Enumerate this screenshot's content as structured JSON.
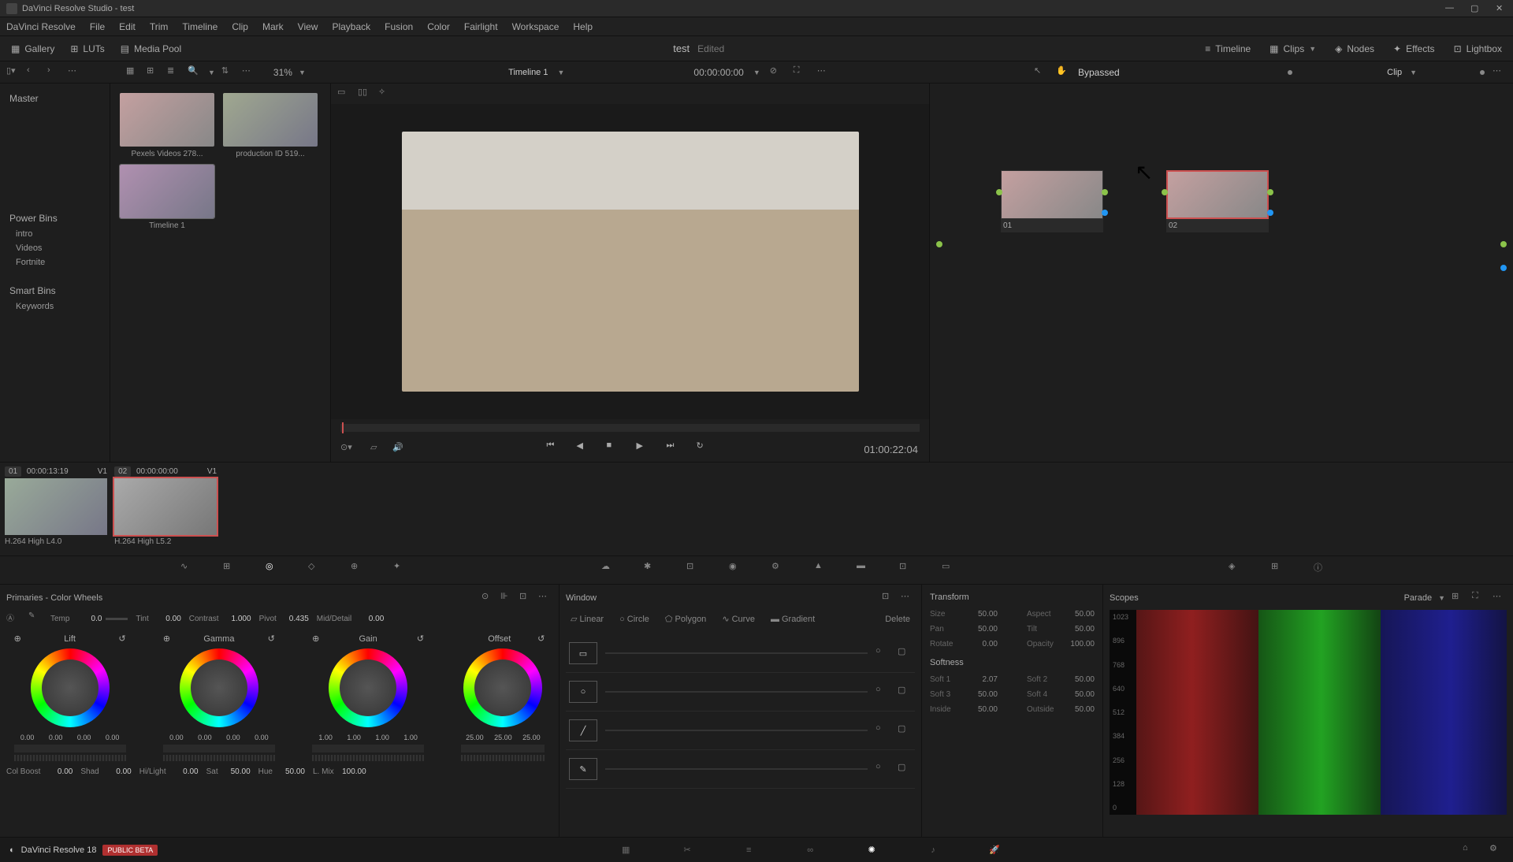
{
  "titlebar": {
    "title": "DaVinci Resolve Studio - test"
  },
  "menubar": [
    "DaVinci Resolve",
    "File",
    "Edit",
    "Trim",
    "Timeline",
    "Clip",
    "Mark",
    "View",
    "Playback",
    "Fusion",
    "Color",
    "Fairlight",
    "Workspace",
    "Help"
  ],
  "toolbar": {
    "gallery": "Gallery",
    "luts": "LUTs",
    "mediapool": "Media Pool",
    "project": "test",
    "status": "Edited",
    "timeline": "Timeline",
    "clips": "Clips",
    "nodes": "Nodes",
    "effects": "Effects",
    "lightbox": "Lightbox"
  },
  "sectoolbar": {
    "zoom": "31%",
    "timeline_name": "Timeline 1",
    "timecode": "00:00:00:00",
    "bypassed": "Bypassed",
    "clip_label": "Clip"
  },
  "sidebar": {
    "master": "Master",
    "powerbins": "Power Bins",
    "power_items": [
      "intro",
      "Videos",
      "Fortnite"
    ],
    "smartbins": "Smart Bins",
    "smart_items": [
      "Keywords"
    ]
  },
  "media": {
    "items": [
      {
        "label": "Pexels Videos 278..."
      },
      {
        "label": "production ID 519..."
      },
      {
        "label": "Timeline 1"
      }
    ]
  },
  "viewer": {
    "timecode": "01:00:22:04"
  },
  "nodes": [
    {
      "label": "01",
      "selected": false
    },
    {
      "label": "02",
      "selected": true
    }
  ],
  "clips": [
    {
      "num": "01",
      "tc": "00:00:13:19",
      "track": "V1",
      "codec": "H.264 High L4.0",
      "selected": false
    },
    {
      "num": "02",
      "tc": "00:00:00:00",
      "track": "V1",
      "codec": "H.264 High L5.2",
      "selected": true
    }
  ],
  "colorpanel": {
    "title": "Primaries - Color Wheels",
    "adjustments": {
      "temp_label": "Temp",
      "temp": "0.0",
      "tint_label": "Tint",
      "tint": "0.00",
      "contrast_label": "Contrast",
      "contrast": "1.000",
      "pivot_label": "Pivot",
      "pivot": "0.435",
      "md_label": "Mid/Detail",
      "md": "0.00"
    },
    "wheels": {
      "lift_label": "Lift",
      "lift_vals": [
        "0.00",
        "0.00",
        "0.00",
        "0.00"
      ],
      "gamma_label": "Gamma",
      "gamma_vals": [
        "0.00",
        "0.00",
        "0.00",
        "0.00"
      ],
      "gain_label": "Gain",
      "gain_vals": [
        "1.00",
        "1.00",
        "1.00",
        "1.00"
      ],
      "offset_label": "Offset",
      "offset_vals": [
        "25.00",
        "25.00",
        "25.00"
      ]
    },
    "bottom": {
      "colboost_label": "Col Boost",
      "colboost": "0.00",
      "shad_label": "Shad",
      "shad": "0.00",
      "hilight_label": "Hi/Light",
      "hilight": "0.00",
      "sat_label": "Sat",
      "sat": "50.00",
      "hue_label": "Hue",
      "hue": "50.00",
      "lmix_label": "L. Mix",
      "lmix": "100.00"
    }
  },
  "windowpanel": {
    "title": "Window",
    "shapes": [
      "Linear",
      "Circle",
      "Polygon",
      "Curve",
      "Gradient"
    ],
    "delete": "Delete"
  },
  "transform": {
    "title": "Transform",
    "size_label": "Size",
    "size": "50.00",
    "aspect_label": "Aspect",
    "aspect": "50.00",
    "pan_label": "Pan",
    "pan": "50.00",
    "tilt_label": "Tilt",
    "tilt": "50.00",
    "rotate_label": "Rotate",
    "rotate": "0.00",
    "opacity_label": "Opacity",
    "opacity": "100.00",
    "softness_title": "Softness",
    "soft1_label": "Soft 1",
    "soft1": "2.07",
    "soft2_label": "Soft 2",
    "soft2": "50.00",
    "soft3_label": "Soft 3",
    "soft3": "50.00",
    "soft4_label": "Soft 4",
    "soft4": "50.00",
    "inside_label": "Inside",
    "inside": "50.00",
    "outside_label": "Outside",
    "outside": "50.00"
  },
  "scopes": {
    "title": "Scopes",
    "mode": "Parade",
    "scale": [
      "1023",
      "896",
      "768",
      "640",
      "512",
      "384",
      "256",
      "128",
      "0"
    ]
  },
  "bottombar": {
    "version": "DaVinci Resolve 18",
    "beta": "PUBLIC BETA"
  }
}
